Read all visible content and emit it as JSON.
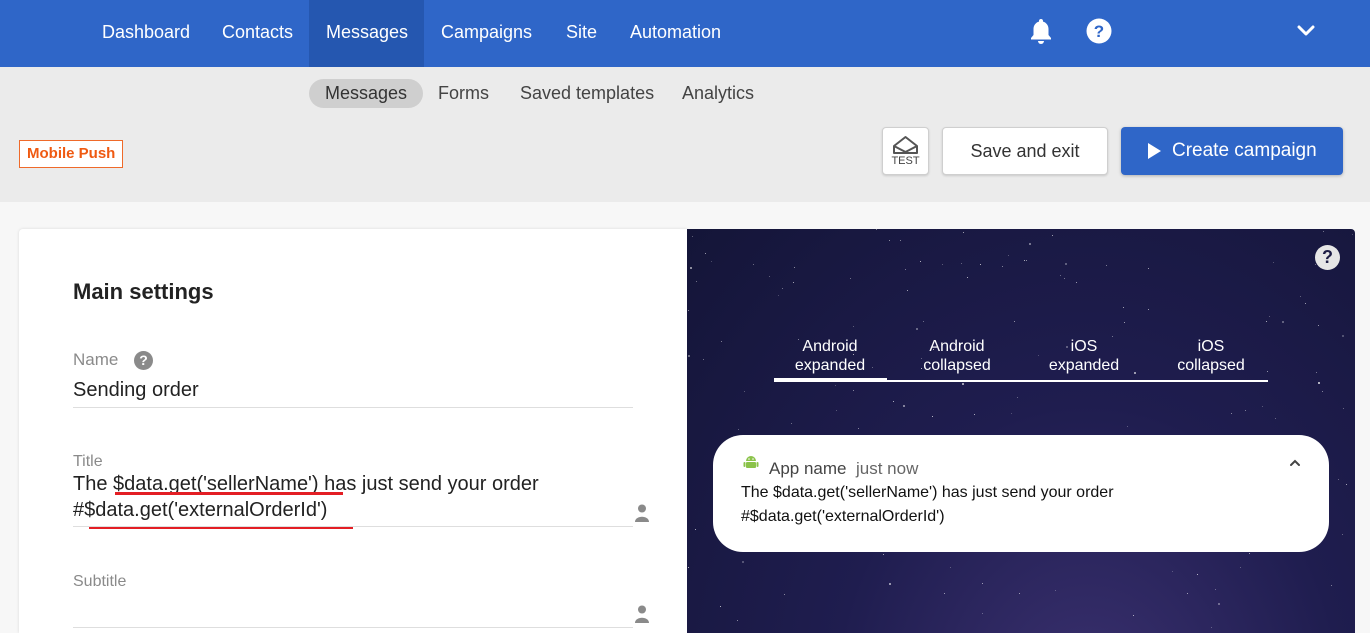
{
  "topnav": {
    "items": [
      {
        "label": "Dashboard"
      },
      {
        "label": "Contacts"
      },
      {
        "label": "Messages",
        "active": true
      },
      {
        "label": "Campaigns"
      },
      {
        "label": "Site"
      },
      {
        "label": "Automation"
      }
    ],
    "icons": [
      "bell-icon",
      "help-icon",
      "chevron-down-icon"
    ]
  },
  "subnav": {
    "tabs": [
      {
        "label": "Messages",
        "active": true
      },
      {
        "label": "Forms"
      },
      {
        "label": "Saved templates"
      },
      {
        "label": "Analytics"
      }
    ]
  },
  "toolbar": {
    "badge": "Mobile Push",
    "test_label": "TEST",
    "save_label": "Save and exit",
    "create_label": "Create campaign"
  },
  "main": {
    "section_title": "Main settings",
    "name_label": "Name",
    "name_value": "Sending order",
    "title_label": "Title",
    "title_line1_pre": "The ",
    "title_line1_var": "$data.get('sellerName')",
    "title_line1_post": " has just send your order",
    "title_line2": "#$data.get('externalOrderId')",
    "subtitle_label": "Subtitle",
    "subtitle_value": ""
  },
  "preview": {
    "tabs": [
      {
        "line1": "Android",
        "line2": "expanded",
        "active": true
      },
      {
        "line1": "Android",
        "line2": "collapsed"
      },
      {
        "line1": "iOS",
        "line2": "expanded"
      },
      {
        "line1": "iOS",
        "line2": "collapsed"
      }
    ],
    "notification": {
      "app_name": "App name",
      "time": "just now",
      "body_line1": "The $data.get('sellerName') has just send your order",
      "body_line2": "#$data.get('externalOrderId')"
    }
  },
  "colors": {
    "brand_blue": "#2f66c8",
    "badge_orange": "#ef5a12",
    "underline_red": "#e31e24",
    "android_green": "#8bc34a"
  }
}
